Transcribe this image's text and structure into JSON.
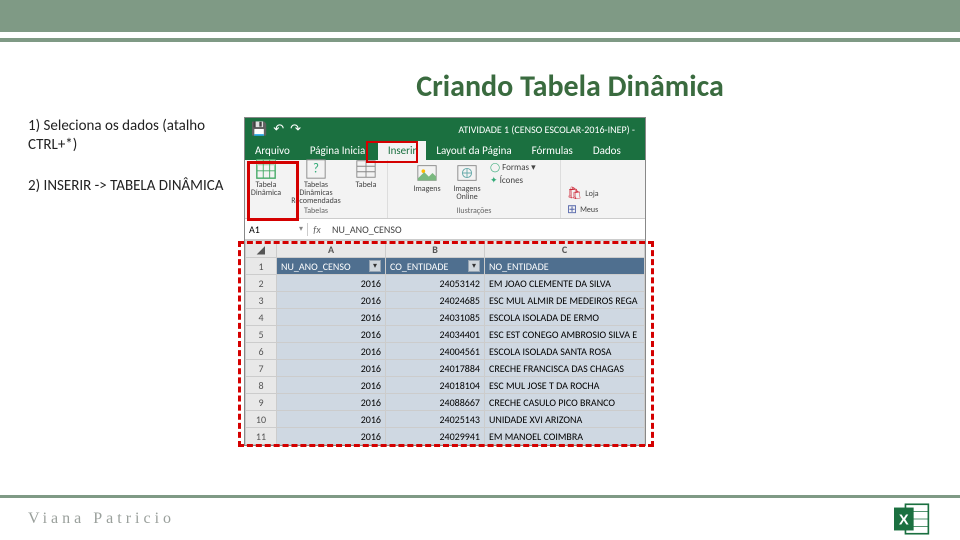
{
  "title": "Criando Tabela Dinâmica",
  "instructions": {
    "step1": "1) Seleciona os dados (atalho CTRL+*)",
    "step2": "2) INSERIR -> TABELA DINÂMICA"
  },
  "excel": {
    "document_title": "ATIVIDADE 1 (CENSO ESCOLAR-2016-INEP) -",
    "qat": {
      "save": "💾",
      "undo": "↶",
      "redo": "↷"
    },
    "tabs": {
      "arquivo": "Arquivo",
      "pagina_inicial": "Página Inicial",
      "inserir": "Inserir",
      "layout": "Layout da Página",
      "formulas": "Fórmulas",
      "dados": "Dados"
    },
    "ribbon": {
      "tabelas": {
        "pivot": "Tabela Dinâmica",
        "recommended": "Tabelas Dinâmicas Recomendadas",
        "table": "Tabela",
        "group": "Tabelas"
      },
      "ilustracoes": {
        "imagens": "Imagens",
        "imagens_online": "Imagens Online",
        "formas": "Formas ▾",
        "icones": "Ícones",
        "group": "Ilustrações"
      },
      "addins": {
        "loja": "Loja",
        "meus": "Meus"
      }
    },
    "namebox": "A1",
    "formula_value": "NU_ANO_CENSO",
    "columns": {
      "a": "A",
      "b": "B",
      "c": "C"
    },
    "headers": {
      "c1": "NU_ANO_CENSO",
      "c2": "CO_ENTIDADE",
      "c3": "NO_ENTIDADE"
    },
    "rows": [
      {
        "n": "2",
        "y": "2016",
        "co": "24053142",
        "no": "EM JOAO CLEMENTE DA SILVA"
      },
      {
        "n": "3",
        "y": "2016",
        "co": "24024685",
        "no": "ESC MUL ALMIR DE MEDEIROS REGA"
      },
      {
        "n": "4",
        "y": "2016",
        "co": "24031085",
        "no": "ESCOLA ISOLADA DE ERMO"
      },
      {
        "n": "5",
        "y": "2016",
        "co": "24034401",
        "no": "ESC EST CONEGO AMBROSIO SILVA E"
      },
      {
        "n": "6",
        "y": "2016",
        "co": "24004561",
        "no": "ESCOLA ISOLADA SANTA ROSA"
      },
      {
        "n": "7",
        "y": "2016",
        "co": "24017884",
        "no": "CRECHE FRANCISCA DAS CHAGAS"
      },
      {
        "n": "8",
        "y": "2016",
        "co": "24018104",
        "no": "ESC MUL JOSE T DA ROCHA"
      },
      {
        "n": "9",
        "y": "2016",
        "co": "24088667",
        "no": "CRECHE CASULO PICO BRANCO"
      },
      {
        "n": "10",
        "y": "2016",
        "co": "24025143",
        "no": "UNIDADE XVI ARIZONA"
      },
      {
        "n": "11",
        "y": "2016",
        "co": "24029941",
        "no": "EM MANOEL COIMBRA"
      }
    ]
  },
  "footer": {
    "brand": "Viana Patricio"
  }
}
